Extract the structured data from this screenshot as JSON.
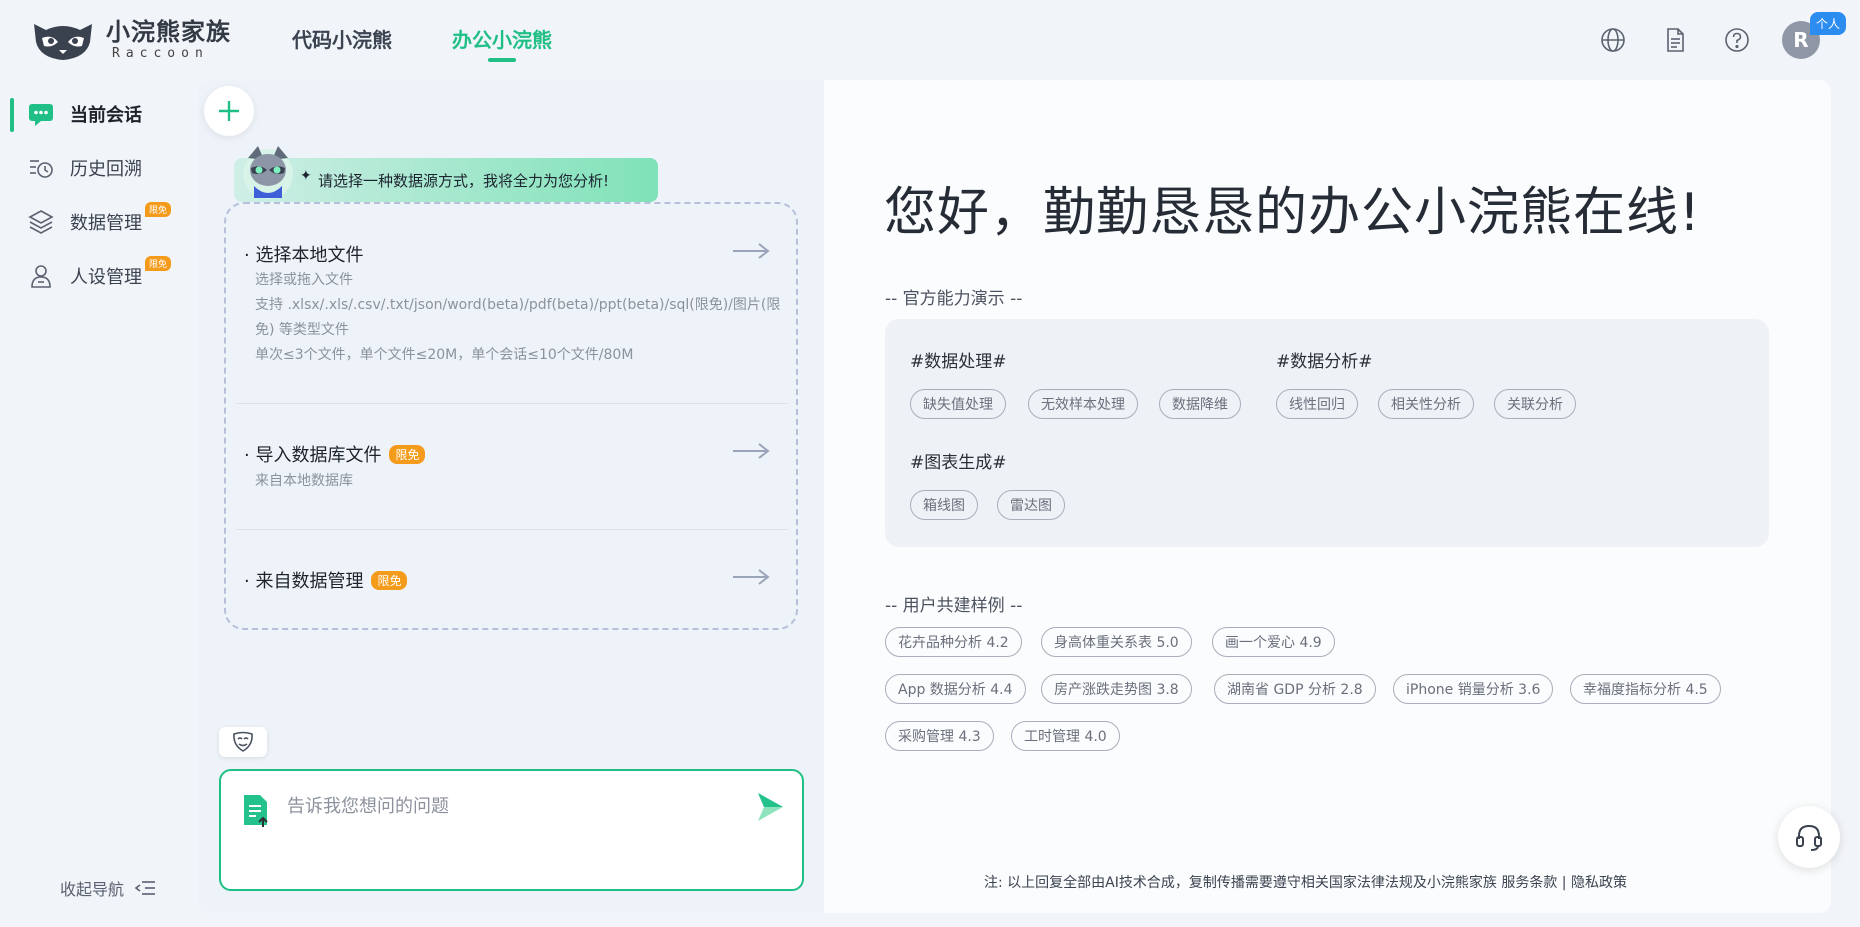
{
  "header": {
    "logo_cn": "小浣熊家族",
    "logo_en": "Raccoon",
    "tabs": [
      {
        "label": "代码小浣熊"
      },
      {
        "label": "办公小浣熊"
      }
    ],
    "avatar_letter": "R",
    "personal_badge": "个人",
    "icons": [
      "globe-icon",
      "document-icon",
      "help-icon"
    ]
  },
  "sidebar": {
    "items": [
      {
        "label": "当前会话",
        "icon": "chat-icon"
      },
      {
        "label": "历史回溯",
        "icon": "history-icon"
      },
      {
        "label": "数据管理",
        "icon": "layers-icon",
        "badge": "限免"
      },
      {
        "label": "人设管理",
        "icon": "person-icon",
        "badge": "限免"
      }
    ],
    "collapse_label": "收起导航"
  },
  "chat": {
    "greeting": "请选择一种数据源方式，我将全力为您分析!",
    "sources": [
      {
        "title": "· 选择本地文件",
        "lines": [
          "选择或拖入文件",
          "支持 .xlsx/.xls/.csv/.txt/json/word(beta)/pdf(beta)/ppt(beta)/sql(限免)/图片(限",
          "免) 等类型文件",
          "单次≤3个文件，单个文件≤20M，单个会话≤10个文件/80M"
        ]
      },
      {
        "title": "· 导入数据库文件",
        "badge": "限免",
        "lines": [
          "来自本地数据库"
        ]
      },
      {
        "title": "· 来自数据管理",
        "badge": "限免",
        "lines": []
      }
    ],
    "input_placeholder": "告诉我您想问的问题"
  },
  "main": {
    "hero": "您好，勤勤恳恳的办公小浣熊在线!",
    "capabilities_label": "-- 官方能力演示 --",
    "capabilities": [
      {
        "head": "#数据处理#",
        "chips": [
          "缺失值处理",
          "无效样本处理",
          "数据降维"
        ]
      },
      {
        "head": "#数据分析#",
        "chips": [
          "线性回归",
          "相关性分析",
          "关联分析"
        ]
      },
      {
        "head": "#图表生成#",
        "chips": [
          "箱线图",
          "雷达图"
        ]
      }
    ],
    "examples_label": "-- 用户共建样例 --",
    "examples": [
      [
        "花卉品种分析 4.2",
        "身高体重关系表 5.0",
        "画一个爱心 4.9"
      ],
      [
        "App 数据分析 4.4",
        "房产涨跌走势图 3.8",
        "湖南省 GDP 分析 2.8",
        "iPhone 销量分析 3.6",
        "幸福度指标分析 4.5"
      ],
      [
        "采购管理 4.3",
        "工时管理 4.0"
      ]
    ],
    "footnote": "注: 以上回复全部由AI技术合成，复制传播需要遵守相关国家法律法规及小浣熊家族 服务条款 | 隐私政策"
  },
  "colors": {
    "accent": "#1fbf86",
    "badge_orange": "#f59b1b",
    "badge_blue": "#2d8cf0"
  }
}
